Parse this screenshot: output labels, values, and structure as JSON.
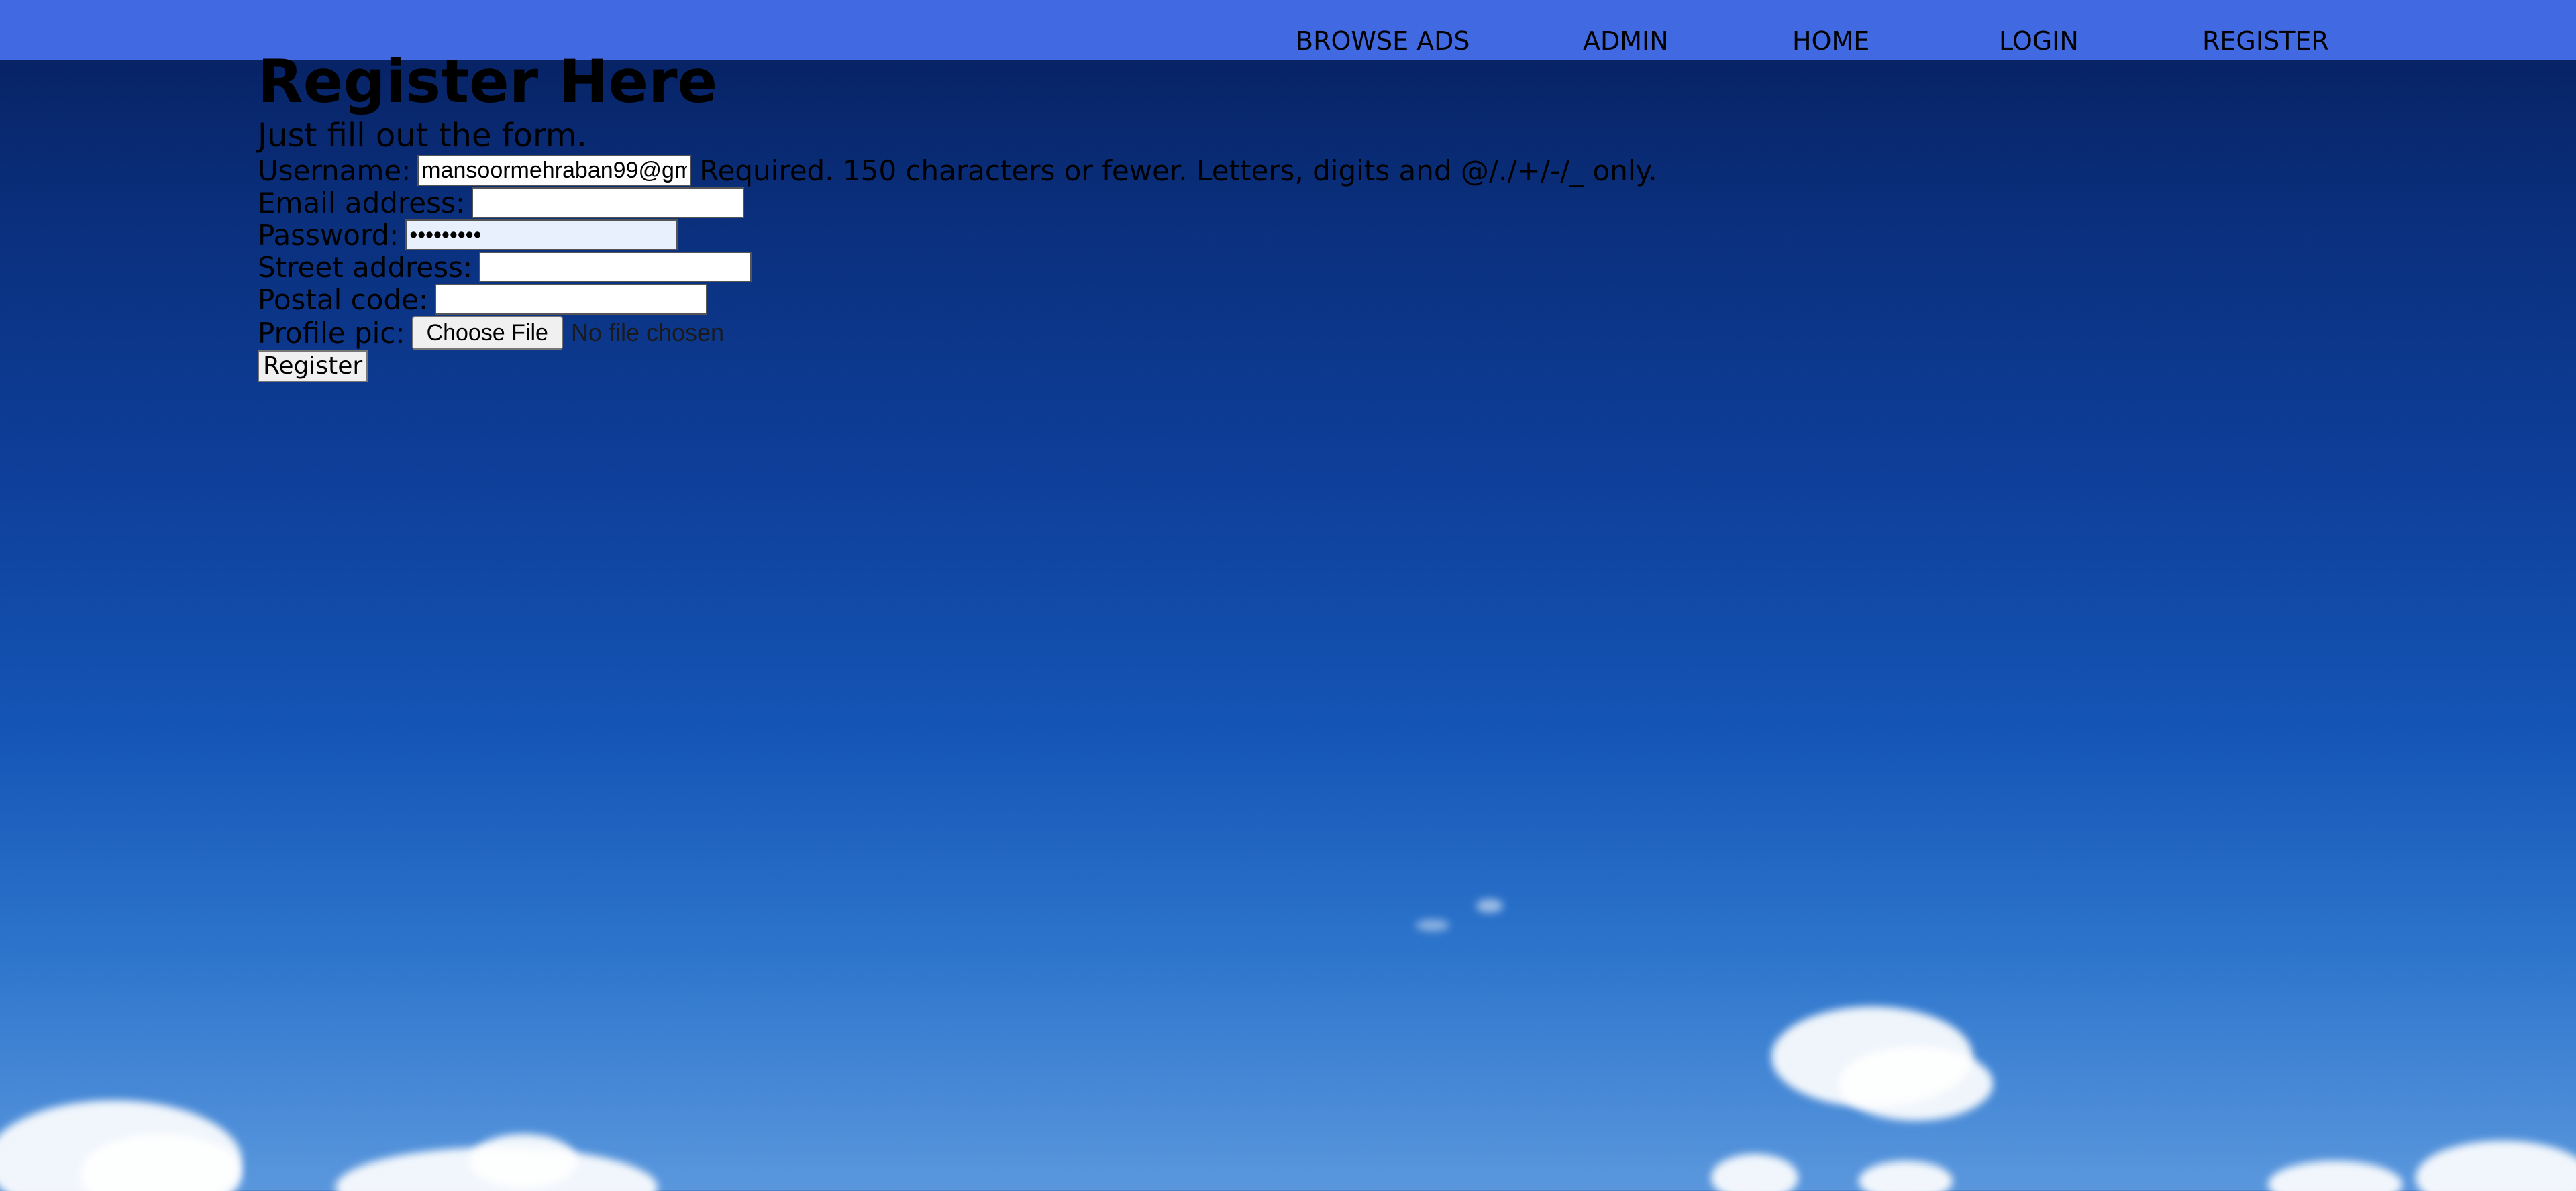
{
  "nav": {
    "items": [
      {
        "label": "BROWSE ADS"
      },
      {
        "label": "ADMIN"
      },
      {
        "label": "HOME"
      },
      {
        "label": "LOGIN"
      },
      {
        "label": "REGISTER"
      }
    ]
  },
  "page": {
    "title": "Register Here",
    "subtitle": "Just fill out the form."
  },
  "form": {
    "username": {
      "label": "Username:",
      "value": "mansoormehraban99@gm",
      "help": "Required. 150 characters or fewer. Letters, digits and @/./+/-/_ only."
    },
    "email": {
      "label": "Email address:",
      "value": ""
    },
    "password": {
      "label": "Password:",
      "value": "•••••••••"
    },
    "street": {
      "label": "Street address:",
      "value": ""
    },
    "postal": {
      "label": "Postal code:",
      "value": ""
    },
    "profile_pic": {
      "label": "Profile pic:",
      "button": "Choose File",
      "status": "No file chosen"
    },
    "submit": "Register"
  },
  "colors": {
    "navbar": "#4169e1",
    "sky_top": "#071f5e",
    "sky_bottom": "#5a97dd"
  }
}
